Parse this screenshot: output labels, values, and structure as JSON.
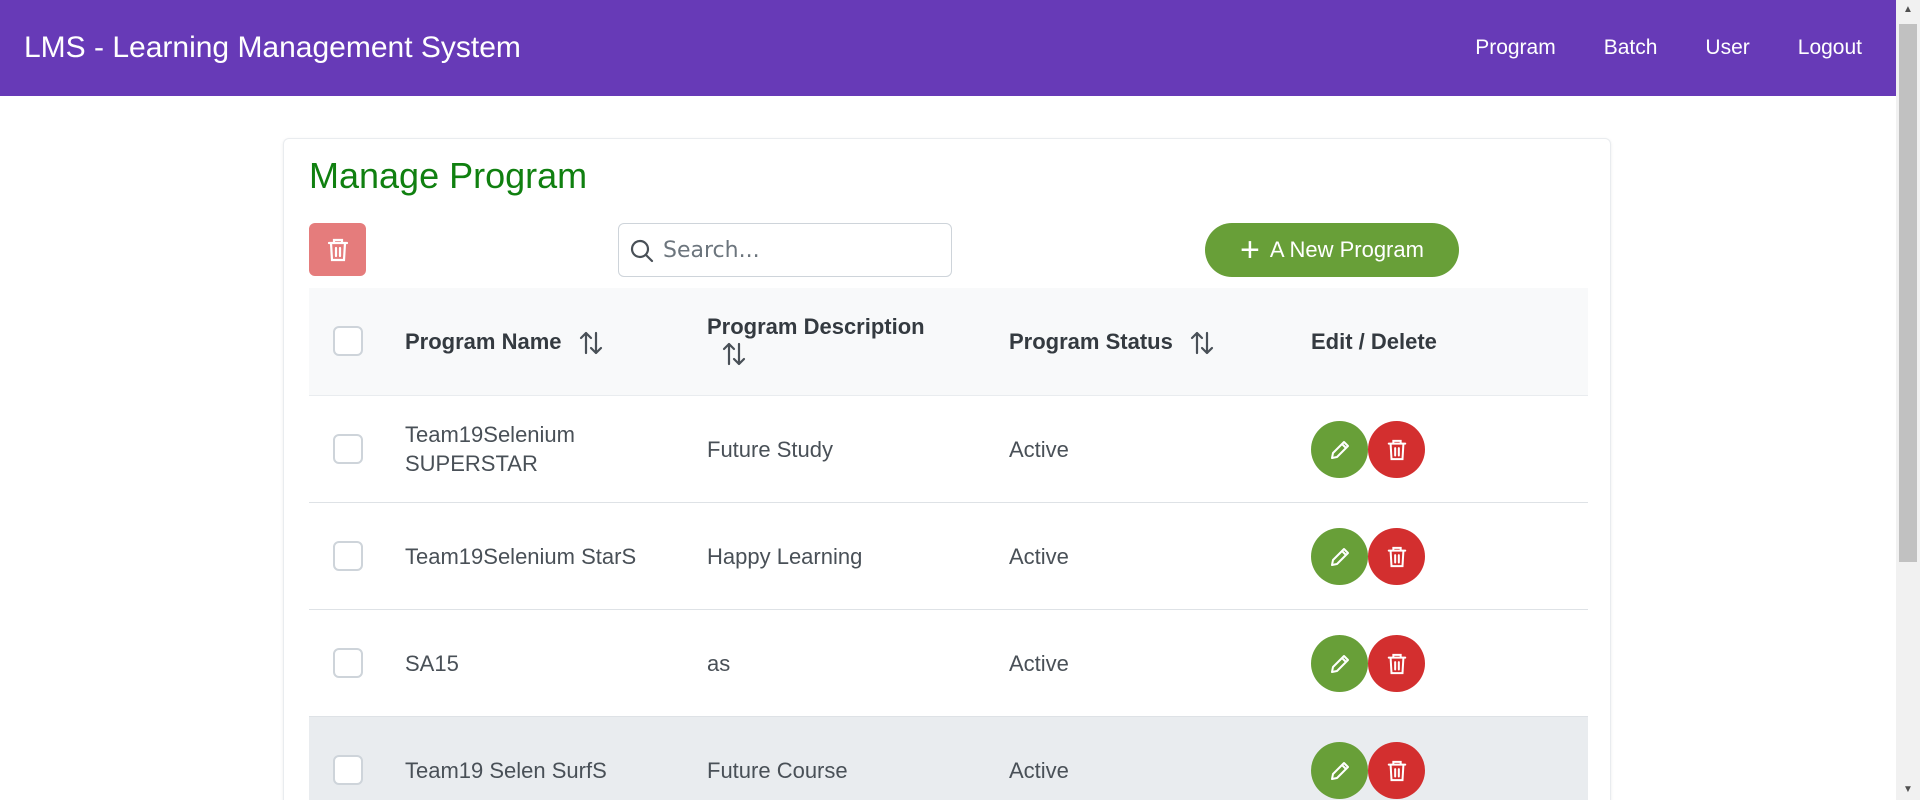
{
  "header": {
    "title": "LMS - Learning Management System",
    "nav": [
      "Program",
      "Batch",
      "User",
      "Logout"
    ],
    "bg_color": "#673ab7"
  },
  "main": {
    "title": "Manage Program",
    "search_placeholder": "Search...",
    "new_button_label": "A New Program",
    "columns": [
      "Program Name",
      "Program Description",
      "Program Status",
      "Edit / Delete"
    ],
    "rows": [
      {
        "name": "Team19Selenium SUPERSTAR",
        "description": "Future Study",
        "status": "Active"
      },
      {
        "name": "Team19Selenium StarS",
        "description": "Happy Learning",
        "status": "Active"
      },
      {
        "name": "SA15",
        "description": "as",
        "status": "Active"
      },
      {
        "name": "Team19 Selen SurfS",
        "description": "Future Course",
        "status": "Active"
      }
    ]
  },
  "colors": {
    "title_green": "#108010",
    "primary_green": "#689f38",
    "danger_red": "#d32f2f",
    "bulk_delete_red": "#e57c7c"
  }
}
